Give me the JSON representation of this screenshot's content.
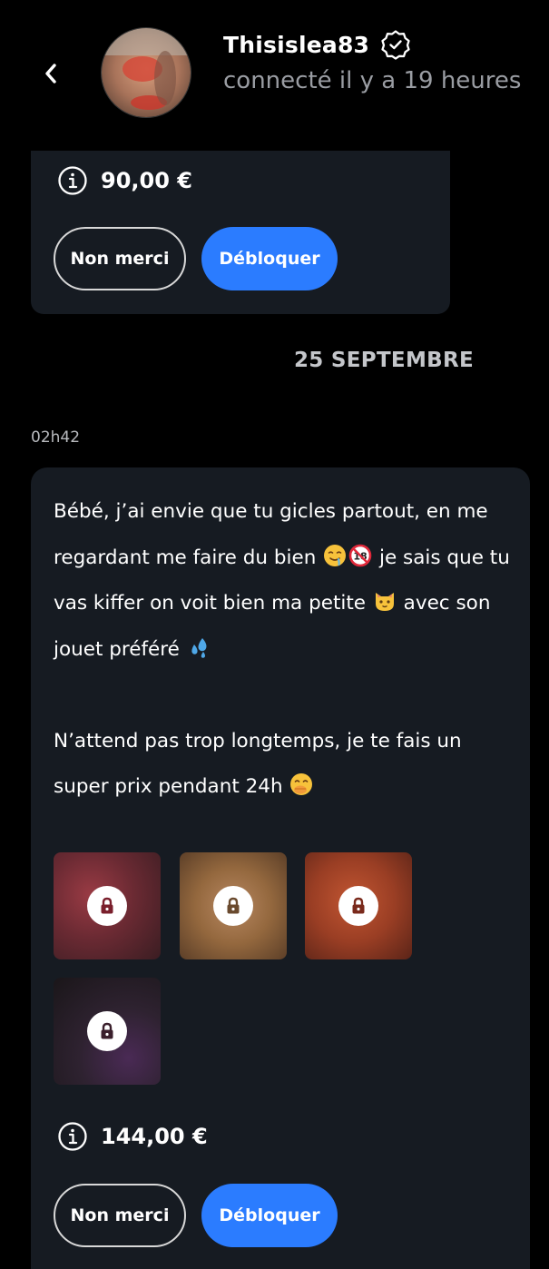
{
  "header": {
    "username": "Thisislea83",
    "status": "connecté il y a 19 heures",
    "back_icon": "chevron-left-icon",
    "verified_icon": "verified-badge-icon"
  },
  "previous_message": {
    "price": "90,00 €",
    "decline_label": "Non merci",
    "unlock_label": "Débloquer"
  },
  "date_separator": "25 SEPTEMBRE",
  "message": {
    "time": "02h42",
    "paragraph1_part1": "Bébé, j’ai envie que tu gicles partout, en me regardant me faire du bien ",
    "paragraph1_part2": " je sais que tu vas kiffer on voit bien ma petite ",
    "paragraph1_part3": " avec son jouet préféré ",
    "paragraph2_part1": "N’attend pas trop longtemps, je te fais un super prix pendant 24h ",
    "emojis": [
      "drooling-face",
      "no-under-18",
      "cat-face",
      "sweat-droplets",
      "face-with-hand-over-mouth"
    ],
    "media": [
      {
        "name": "locked-media-1",
        "icon": "lock-icon"
      },
      {
        "name": "locked-media-2",
        "icon": "lock-icon"
      },
      {
        "name": "locked-media-3",
        "icon": "lock-icon"
      },
      {
        "name": "locked-media-4",
        "icon": "lock-icon"
      }
    ],
    "price": "144,00 €",
    "decline_label": "Non merci",
    "unlock_label": "Débloquer"
  },
  "colors": {
    "background": "#000000",
    "card": "#161b22",
    "accent": "#2b7cff",
    "muted_text": "#9a9da3"
  }
}
